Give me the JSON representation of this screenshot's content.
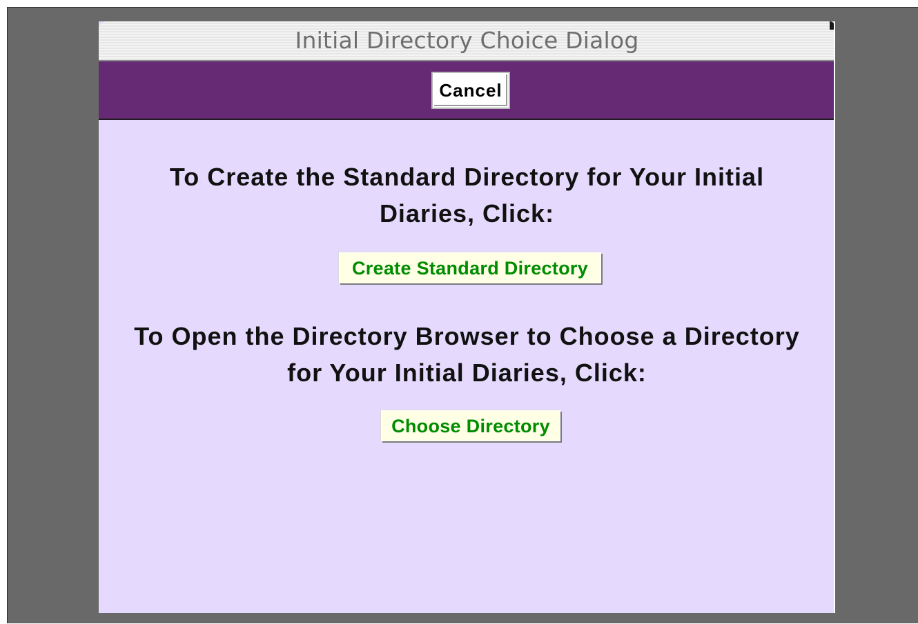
{
  "dialog": {
    "title": "Initial Directory Choice Dialog"
  },
  "toolbar": {
    "cancel_label": "Cancel"
  },
  "main": {
    "instruction_create": "To Create the Standard Directory for Your Initial Diaries, Click:",
    "create_button_label": "Create Standard Directory",
    "instruction_browse": "To Open the Directory Browser to Choose a Directory for Your Initial Diaries, Click:",
    "choose_button_label": "Choose Directory"
  },
  "colors": {
    "backdrop": "#696969",
    "toolbar": "#652a73",
    "content_background": "#e5dafd",
    "action_text": "#008c00",
    "action_button_background": "#ffffe6"
  }
}
